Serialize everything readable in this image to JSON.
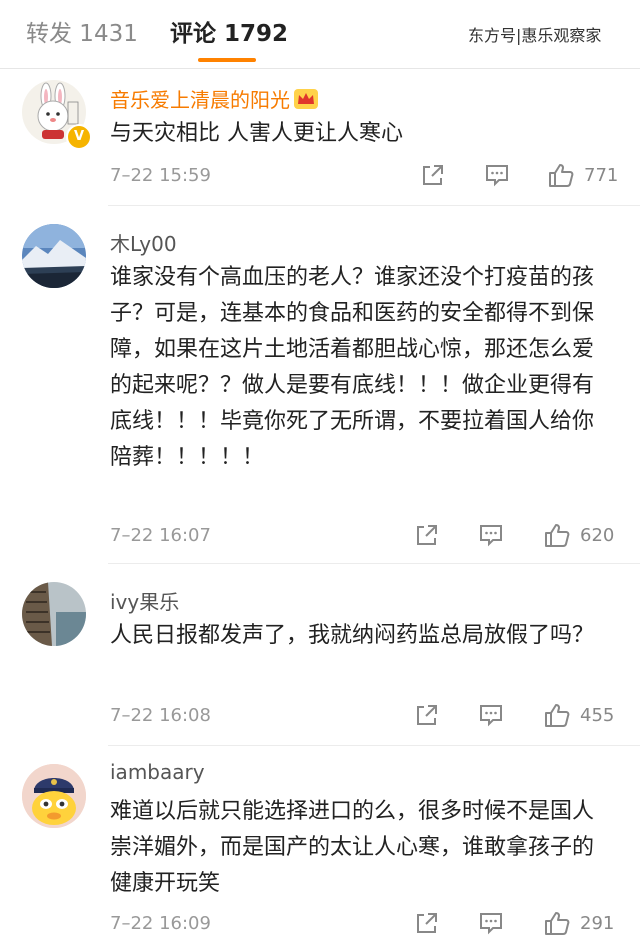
{
  "tabs": {
    "repost": "转发 1431",
    "comments": "评论 1792"
  },
  "watermark": "东方号|惠乐观察家",
  "comments": [
    {
      "user": "音乐爱上清晨的阳光",
      "text": "与天灾相比  人害人更让人寒心",
      "time": "7–22 15:59",
      "likes": "771"
    },
    {
      "user": "木Ly00",
      "text": "谁家没有个高血压的老人？谁家还没个打疫苗的孩子？可是，连基本的食品和医药的安全都得不到保障，如果在这片土地活着都胆战心惊，那还怎么爱的起来呢？？做人是要有底线！！！做企业更得有底线！！！毕竟你死了无所谓，不要拉着国人给你陪葬！！！！！",
      "time": "7–22 16:07",
      "likes": "620"
    },
    {
      "user": "ivy果乐",
      "text": "人民日报都发声了，我就纳闷药监总局放假了吗？",
      "time": "7–22 16:08",
      "likes": "455"
    },
    {
      "user": "iambaary",
      "text": "难道以后就只能选择进口的么，很多时候不是国人崇洋媚外，而是国产的太让人心寒，谁敢拿孩子的健康开玩笑",
      "time": "7–22 16:09",
      "likes": "291"
    }
  ]
}
